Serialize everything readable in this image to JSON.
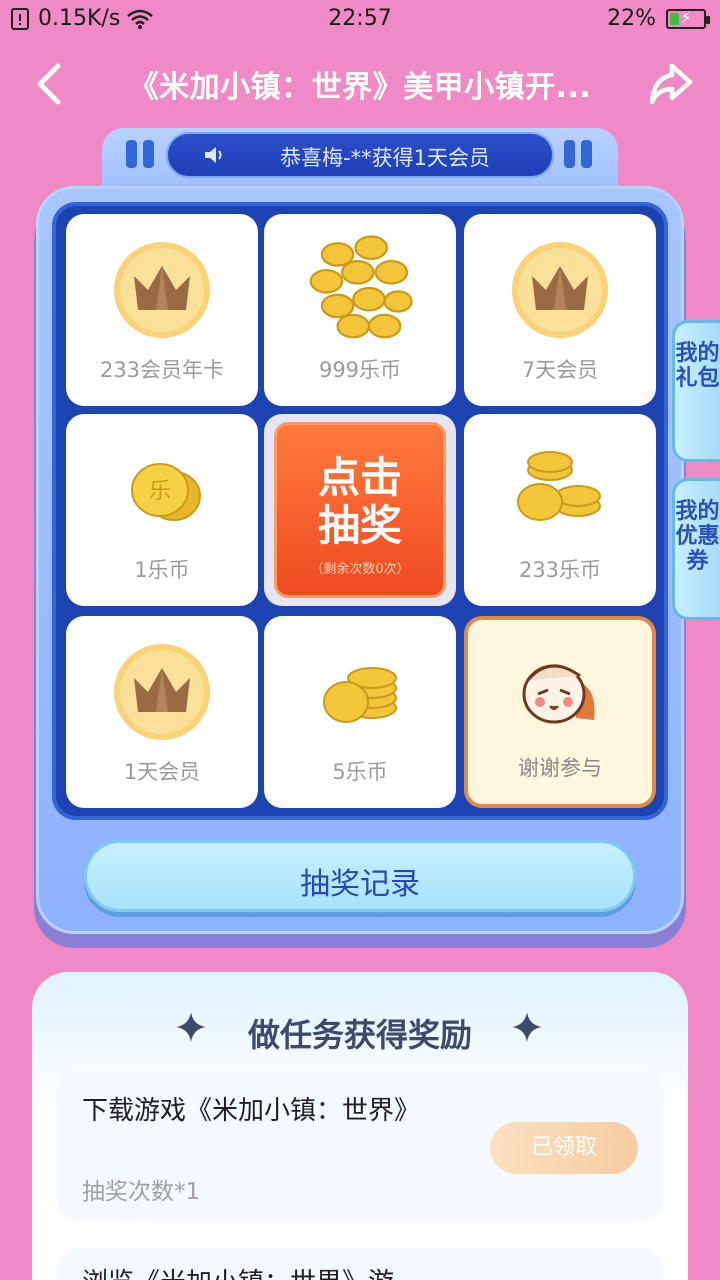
{
  "status_bar": {
    "speed": "0.15K/s",
    "time": "22:57",
    "battery": "22%"
  },
  "header": {
    "title": "《米加小镇：世界》美甲小镇开..."
  },
  "lottery": {
    "marquee": "恭喜梅-**获得1天会员",
    "prizes": [
      {
        "label": "233会员年卡",
        "icon": "crown-icon"
      },
      {
        "label": "999乐币",
        "icon": "coin-pile-icon"
      },
      {
        "label": "7天会员",
        "icon": "crown-icon"
      },
      {
        "label": "1乐币",
        "icon": "coin-icon"
      },
      {
        "label": "233乐币",
        "icon": "coin-stack-icon"
      },
      {
        "label": "1天会员",
        "icon": "crown-icon"
      },
      {
        "label": "5乐币",
        "icon": "coin-stack-icon"
      },
      {
        "label": "谢谢参与",
        "icon": "mascot-icon"
      }
    ],
    "draw_button": {
      "line1": "点击",
      "line2": "抽奖",
      "remaining": "（剩余次数0次）"
    },
    "record_button": "抽奖记录"
  },
  "side_tabs": {
    "gift": "我的礼包",
    "coupon": "我的优惠券"
  },
  "tasks": {
    "title": "做任务获得奖励",
    "items": [
      {
        "name": "下载游戏《米加小镇：世界》",
        "reward": "抽奖次数*1",
        "button": "已领取"
      },
      {
        "name": "浏览《米加小镇：世界》游"
      }
    ]
  }
}
